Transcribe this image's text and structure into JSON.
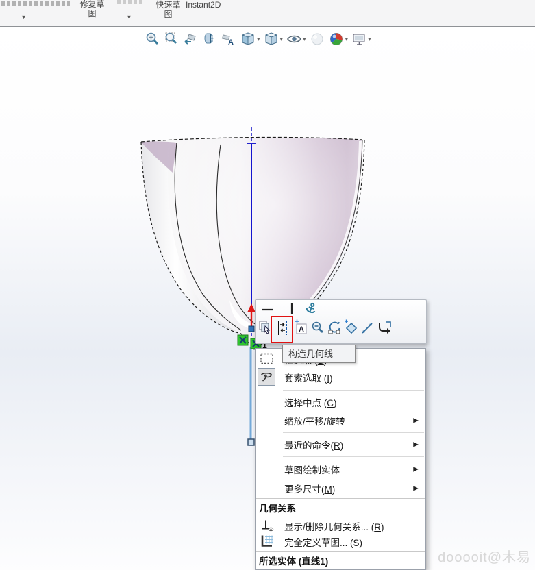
{
  "window": {
    "watermark": "dooooit@木易"
  },
  "ribbon": {
    "items": [
      {
        "id": "clipped-left-button",
        "label": "",
        "clipped": true,
        "has_dropdown": true
      },
      {
        "id": "repair-sketch-button",
        "line1": "修复草",
        "line2": "图",
        "has_dropdown": false
      },
      {
        "id": "clipped-mid-button",
        "label": "",
        "clipped": true,
        "has_dropdown": true
      },
      {
        "id": "rapid-sketch-button",
        "line1": "快速草",
        "line2": "图",
        "has_dropdown": false
      },
      {
        "id": "instant2d-button",
        "label": "Instant2D",
        "has_dropdown": false
      }
    ]
  },
  "heads_up": {
    "buttons": [
      {
        "name": "zoom-to-fit",
        "caret": false
      },
      {
        "name": "zoom-to-area",
        "caret": false
      },
      {
        "name": "previous-view",
        "caret": false
      },
      {
        "name": "section-view",
        "caret": false
      },
      {
        "name": "annotation-view",
        "caret": false
      },
      {
        "name": "view-orientation",
        "caret": true
      },
      {
        "name": "display-style",
        "caret": true
      },
      {
        "name": "hide-show-items",
        "caret": true
      },
      {
        "name": "edit-appearance",
        "caret": false
      },
      {
        "name": "apply-scene",
        "caret": true
      },
      {
        "name": "view-settings",
        "caret": true
      }
    ]
  },
  "context_toolbar": {
    "row1": [
      "make-horizontal",
      "make-vertical",
      "fix-anchor"
    ],
    "row2": [
      "select-other",
      "construction-geometry",
      "note",
      "zoom-selection",
      "replace-entity",
      "sketch-pattern",
      "dimension",
      "exit-sketch"
    ],
    "highlighted": "construction-geometry",
    "highlight_color": "#e01212"
  },
  "tooltip": {
    "text": "构造几何线"
  },
  "context_menu": {
    "items": [
      {
        "pre": "框选取 (",
        "key": "B",
        "post": ")",
        "submenu": false
      },
      {
        "pre": "套索选取 (",
        "key": "I",
        "post": ")",
        "submenu": false
      },
      {
        "pre": "选择中点 (",
        "key": "C",
        "post": ")",
        "submenu": false
      },
      {
        "pre": "缩放/平移/旋转",
        "key": "",
        "post": "",
        "submenu": true
      },
      {
        "pre": "最近的命令(",
        "key": "R",
        "post": ")",
        "submenu": true
      },
      {
        "pre": "草图绘制实体",
        "key": "",
        "post": "",
        "submenu": true
      },
      {
        "pre": "更多尺寸(",
        "key": "M",
        "post": ")",
        "submenu": true
      },
      {
        "pre": "显示/删除几何关系... (",
        "key": "R",
        "post": ")",
        "submenu": false
      },
      {
        "pre": "完全定义草图... (",
        "key": "S",
        "post": ")",
        "submenu": false
      }
    ],
    "headers": [
      {
        "text": "几何关系"
      },
      {
        "text": "所选实体 (直线1)"
      }
    ]
  },
  "sketch": {
    "relation_badge_count": "1",
    "selected_entity": "直线1"
  },
  "colors": {
    "selected_line": "#1515cf",
    "lower_line": "#74a9d8",
    "arrow_red": "#e01818",
    "relation_green": "#2ec42e",
    "viewport_tint": "#e9edf4"
  }
}
